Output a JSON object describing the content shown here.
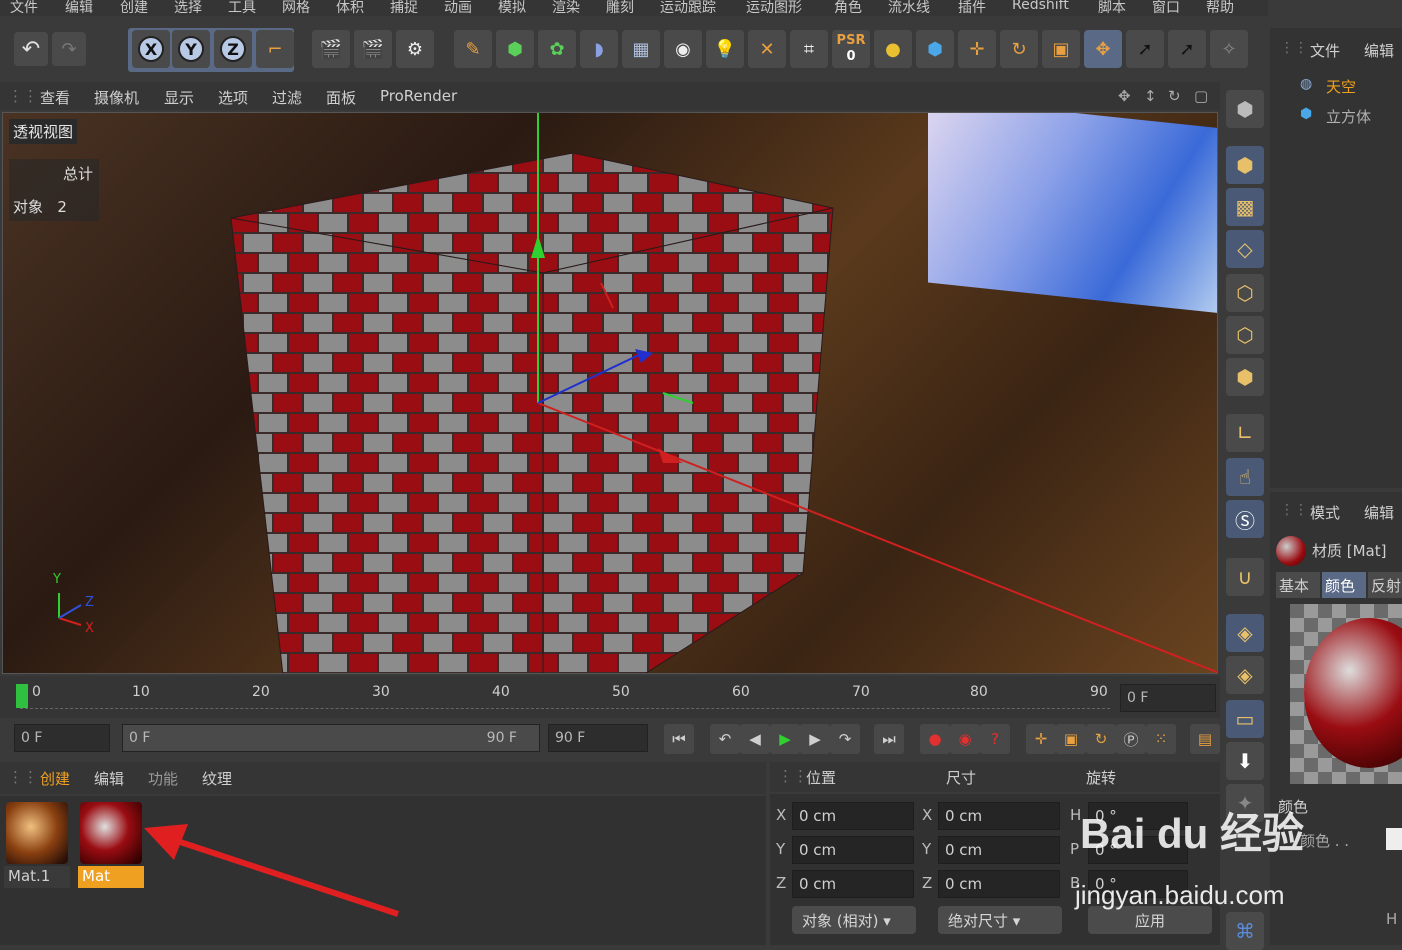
{
  "menu": [
    "文件",
    "编辑",
    "创建",
    "选择",
    "工具",
    "网格",
    "体积",
    "捕捉",
    "动画",
    "模拟",
    "渲染",
    "雕刻",
    "运动跟踪",
    "运动图形",
    "角色",
    "流水线",
    "插件",
    "Redshift",
    "脚本",
    "窗口",
    "帮助"
  ],
  "toolbar": {
    "axis_x": "X",
    "axis_y": "Y",
    "axis_z": "Z",
    "psr_label": "PSR",
    "psr_value": "0"
  },
  "view_menu": [
    "查看",
    "摄像机",
    "显示",
    "选项",
    "过滤",
    "面板",
    "ProRender"
  ],
  "viewport": {
    "title": "透视视图",
    "stats_header": "总计",
    "stats_label": "对象",
    "stats_value": "2",
    "axis_y": "Y",
    "axis_z": "Z",
    "axis_x": "X"
  },
  "object_panel": {
    "menu_file": "文件",
    "menu_edit": "编辑",
    "items": [
      {
        "label": "天空",
        "color": "#f0a020"
      },
      {
        "label": "立方体",
        "color": "#b0b0b0"
      }
    ]
  },
  "attr_panel": {
    "menu_mode": "模式",
    "menu_edit": "编辑",
    "material_title": "材质 [Mat]",
    "tabs": [
      "基本",
      "颜色",
      "反射"
    ],
    "section": "颜色",
    "label_color": "颜色 . .",
    "label_h": "H"
  },
  "timeline": {
    "ticks": [
      "0",
      "10",
      "20",
      "30",
      "40",
      "50",
      "60",
      "70",
      "80",
      "90"
    ],
    "current_frame": "0 F"
  },
  "transport": {
    "start": "0 F",
    "range_start": "0 F",
    "range_end": "90 F",
    "end": "90 F"
  },
  "material_menu": [
    "创建",
    "编辑",
    "功能",
    "纹理"
  ],
  "materials": [
    {
      "name": "Mat.1"
    },
    {
      "name": "Mat",
      "selected": true
    }
  ],
  "coords": {
    "headers": [
      "位置",
      "尺寸",
      "旋转"
    ],
    "rows": [
      {
        "axis": "X",
        "pos": "0 cm",
        "size_axis": "X",
        "size": "0 cm",
        "rot_axis": "H",
        "rot": "0 °"
      },
      {
        "axis": "Y",
        "pos": "0 cm",
        "size_axis": "Y",
        "size": "0 cm",
        "rot_axis": "P",
        "rot": "0 °"
      },
      {
        "axis": "Z",
        "pos": "0 cm",
        "size_axis": "Z",
        "size": "0 cm",
        "rot_axis": "B",
        "rot": "0 °"
      }
    ],
    "mode_dropdown": "对象 (相对)",
    "size_dropdown": "绝对尺寸",
    "apply_button": "应用"
  },
  "watermark": {
    "brand": "Bai du 经验",
    "url": "jingyan.baidu.com"
  },
  "colors": {
    "accent": "#f0a020",
    "brick_red": "#9a0d12",
    "brick_gray": "#8c8c8c"
  }
}
